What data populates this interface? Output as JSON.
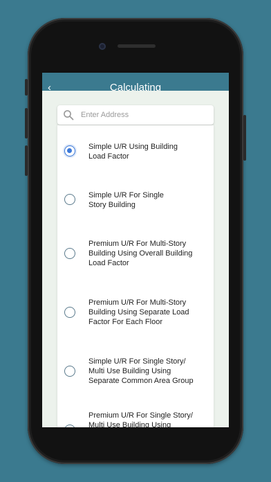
{
  "nav": {
    "title": "Calculating",
    "back_label": "‹"
  },
  "search": {
    "placeholder": "Enter Address",
    "icon": "search-icon"
  },
  "options": [
    {
      "label_lines": [
        "Simple U/R Using Building",
        "Load Factor"
      ],
      "selected": true
    },
    {
      "label_lines": [
        "Simple U/R For Single",
        "Story Building"
      ],
      "selected": false
    },
    {
      "label_lines": [
        "Premium U/R For Multi-Story",
        "Building Using Overall Building",
        "Load Factor"
      ],
      "selected": false
    },
    {
      "label_lines": [
        "Premium U/R For Multi-Story",
        "Building Using Separate Load",
        "Factor For Each Floor"
      ],
      "selected": false
    },
    {
      "label_lines": [
        "Simple U/R For Single Story/",
        "Multi Use Building Using",
        "Separate Common Area Group"
      ],
      "selected": false
    },
    {
      "label_lines": [
        "Premium U/R For Single Story/",
        "Multi Use Building Using"
      ],
      "selected": false
    }
  ],
  "colors": {
    "background": "#3b7a8f",
    "accent": "#3b78d8",
    "screen_bg": "#ecf2ec"
  }
}
